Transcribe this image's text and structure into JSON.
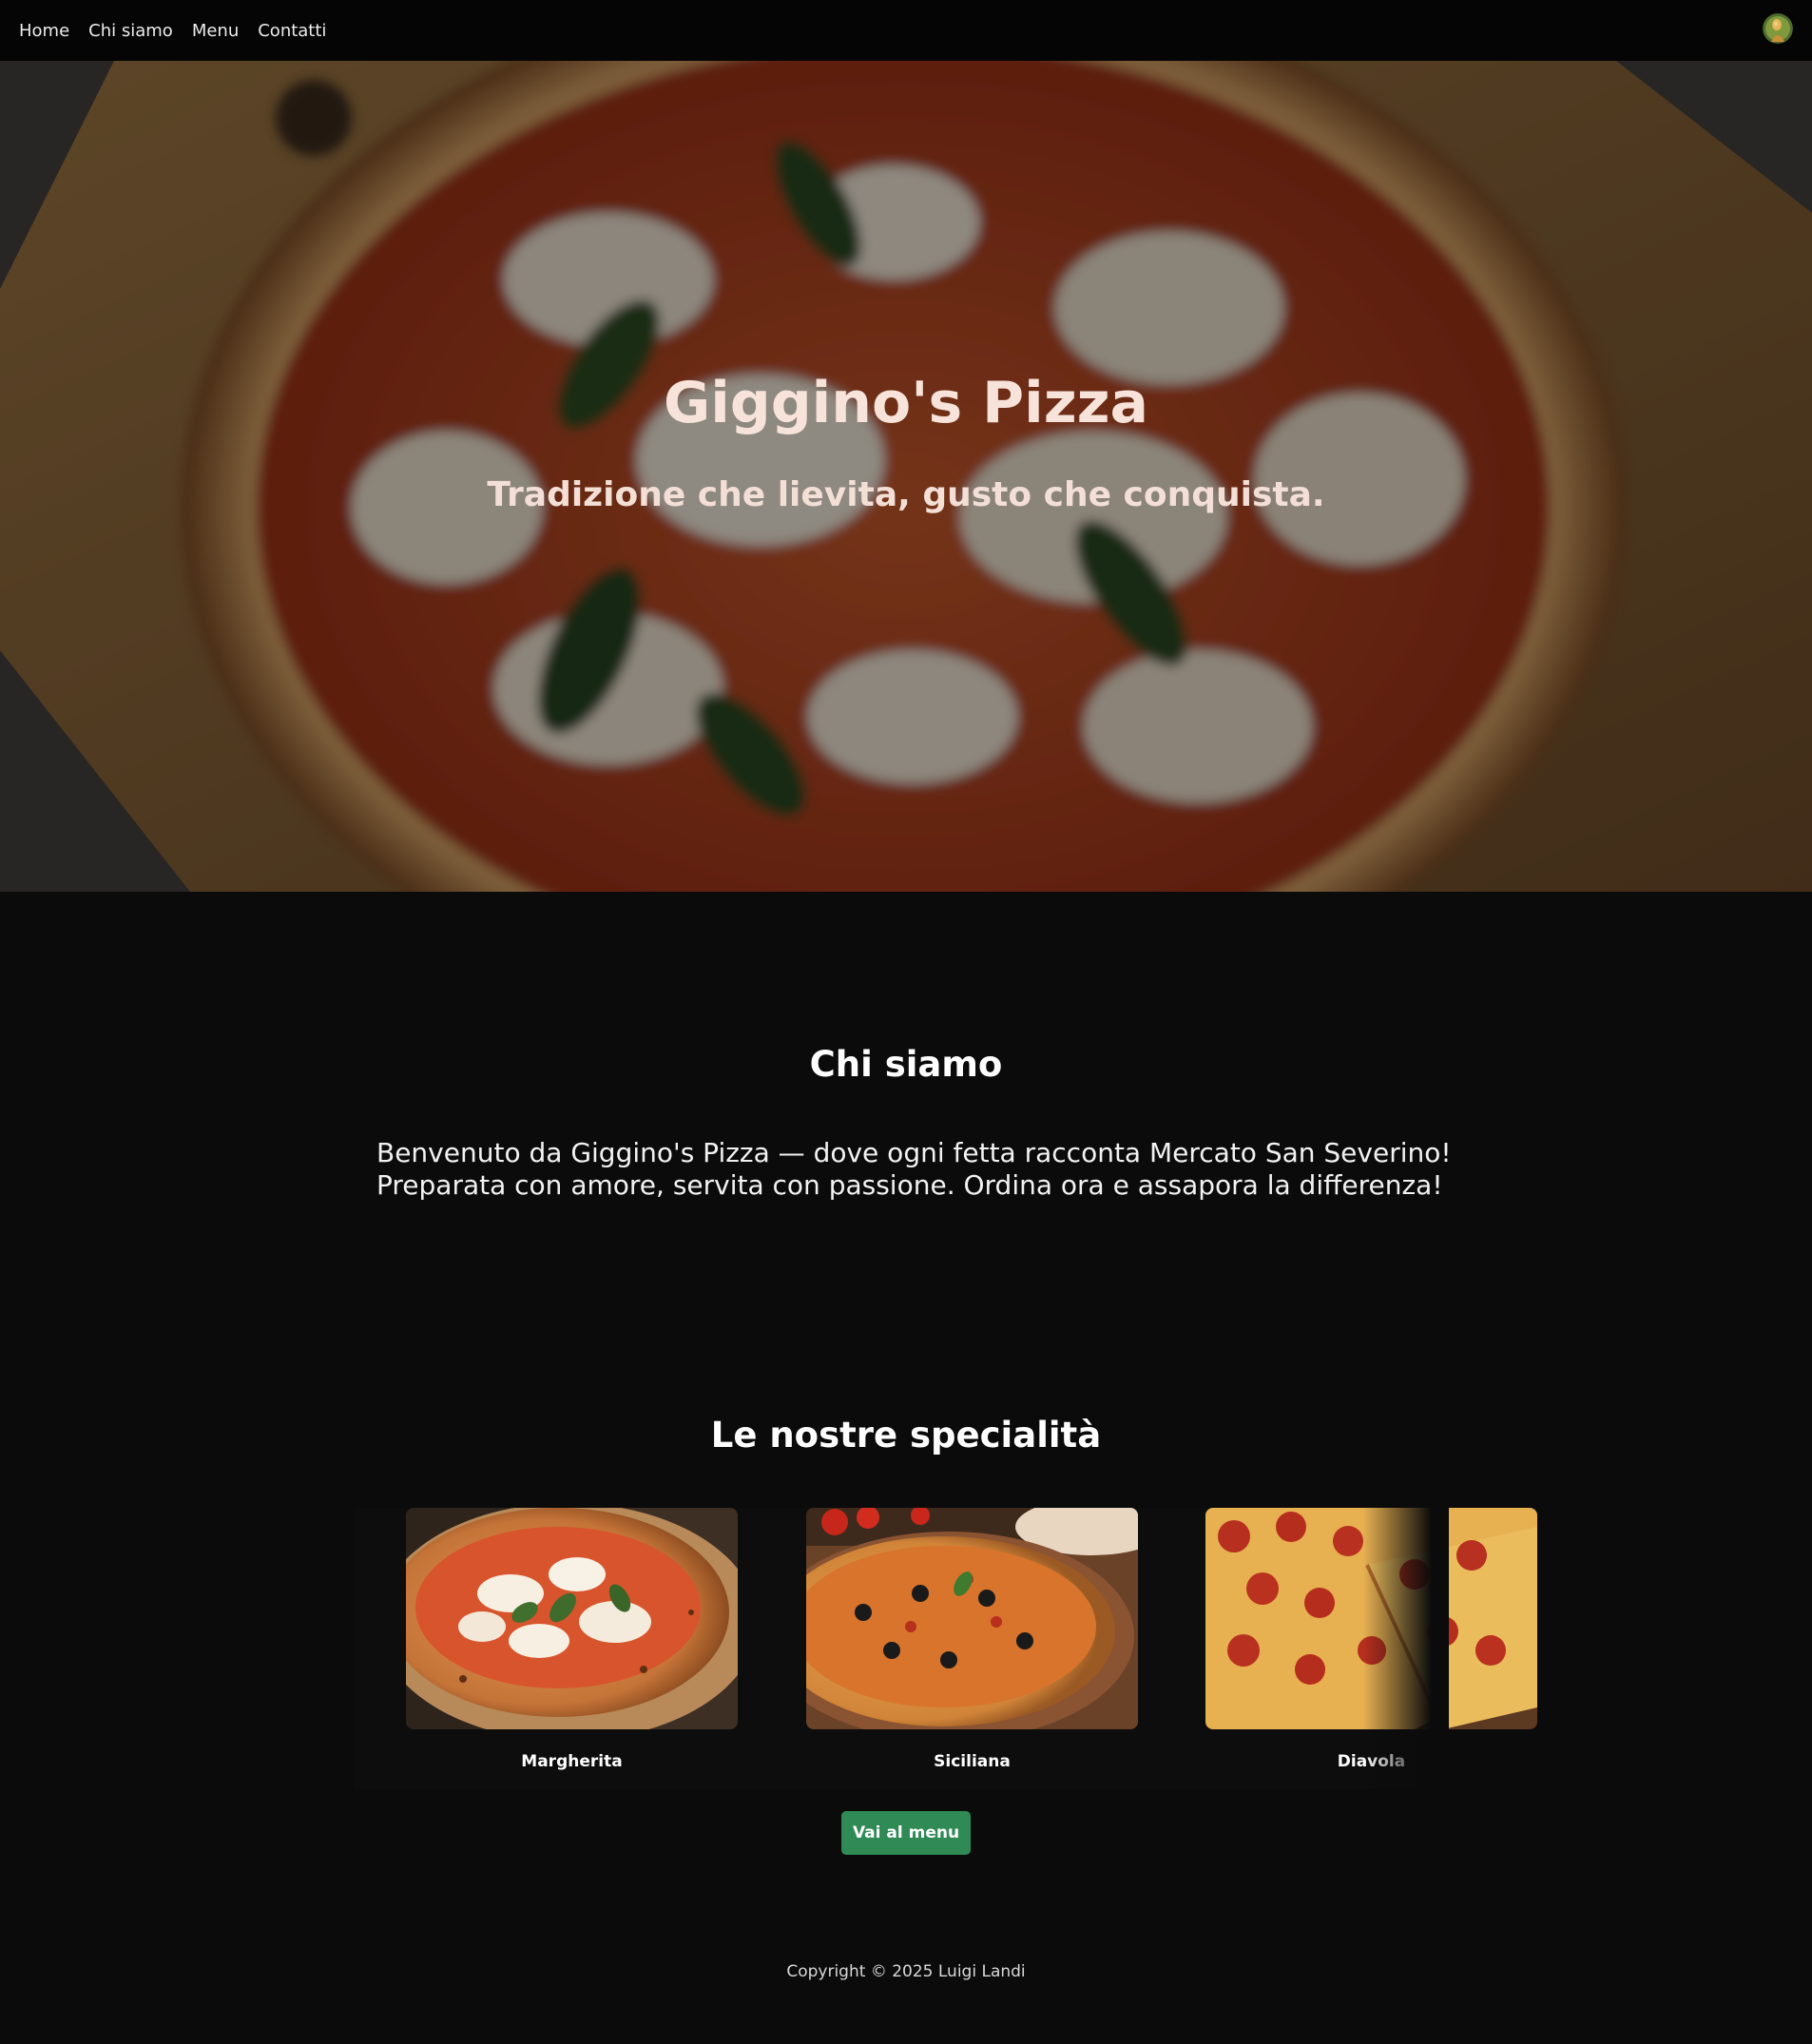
{
  "nav": {
    "links": [
      "Home",
      "Chi siamo",
      "Menu",
      "Contatti"
    ]
  },
  "hero": {
    "title": "Giggino's Pizza",
    "subtitle": "Tradizione che lievita, gusto che conquista."
  },
  "about": {
    "title": "Chi siamo",
    "text_line1": "Benvenuto da Giggino's Pizza — dove ogni fetta racconta Mercato San Severino!",
    "text_line2": "Preparata con amore, servita con passione. Ordina ora e assapora la differenza!"
  },
  "specialties": {
    "title": "Le nostre specialità",
    "items": [
      {
        "name": "Margherita"
      },
      {
        "name": "Siciliana"
      },
      {
        "name": "Diavola"
      }
    ],
    "button_label": "Vai al menu"
  },
  "footer": {
    "copyright": "Copyright © 2025 Luigi Landi"
  },
  "colors": {
    "button": "#2f8a55",
    "background": "#0b0b0b",
    "navbar": "#050505",
    "hero_title": "#f7e3da"
  }
}
